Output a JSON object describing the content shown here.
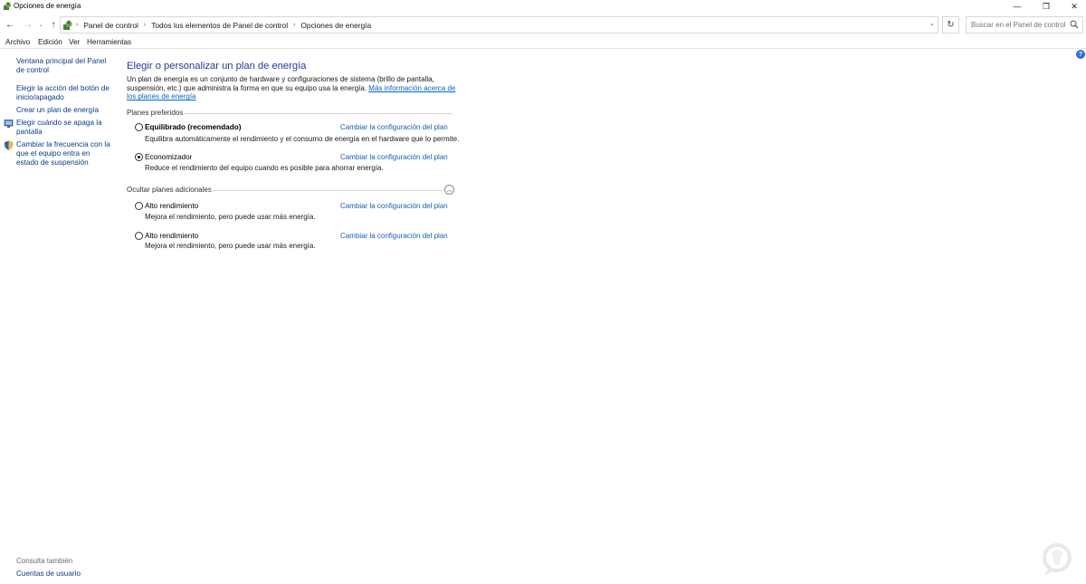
{
  "window": {
    "title": "Opciones de energía",
    "minimize_glyph": "—",
    "maximize_glyph": "❐",
    "close_glyph": "✕"
  },
  "nav": {
    "back_glyph": "←",
    "forward_glyph": "→",
    "recent_glyph": "⌄",
    "up_glyph": "↑",
    "refresh_glyph": "↻",
    "dropdown_glyph": "⌄",
    "breadcrumbs": [
      "Panel de control",
      "Todos los elementos de Panel de control",
      "Opciones de energía"
    ],
    "separator": "›",
    "search_placeholder": "Buscar en el Panel de control"
  },
  "menu": {
    "items": [
      "Archivo",
      "Edición",
      "Ver",
      "Herramientas"
    ]
  },
  "left": {
    "links": [
      "Ventana principal del Panel de control",
      "Elegir la acción del botón de inicio/apagado",
      "Crear un plan de energía",
      "Elegir cuándo se apaga la pantalla",
      "Cambiar la frecuencia con la que el equipo entra en estado de suspensión"
    ],
    "see_also_title": "Consulta también",
    "see_also_links": [
      "Cuentas de usuario"
    ]
  },
  "main": {
    "title": "Elegir o personalizar un plan de energía",
    "description": "Un plan de energía es un conjunto de hardware y configuraciones de sistema (brillo de pantalla, suspensión, etc.) que administra la forma en que su equipo usa la energía.",
    "more_info_link": "Más información acerca de los planes de energía",
    "preferred_heading": "Planes preferidos",
    "additional_heading": "Ocultar planes adicionales",
    "collapse_glyph": "︿",
    "help_glyph": "?",
    "plans": [
      {
        "name": "Equilibrado (recomendado)",
        "description": "Equilibra automáticamente el rendimiento y el consumo de energía en el hardware que lo permite.",
        "link": "Cambiar la configuración del plan",
        "selected": false
      },
      {
        "name": "Economizador",
        "description": "Reduce el rendimiento del equipo cuando es posible para ahorrar energía.",
        "link": "Cambiar la configuración del plan",
        "selected": true
      },
      {
        "name": "Alto rendimiento",
        "description": "Mejora el rendimiento, pero puede usar más energía.",
        "link": "Cambiar la configuración del plan",
        "selected": false
      },
      {
        "name": "Alto rendimiento",
        "description": "Mejora el rendimiento, pero puede usar más energía.",
        "link": "Cambiar la configuración del plan",
        "selected": false
      }
    ]
  },
  "colors": {
    "link": "#0a3c8a",
    "title": "#1e3a8f",
    "plan_link": "#1a5fb4",
    "help": "#2b6ed4"
  }
}
